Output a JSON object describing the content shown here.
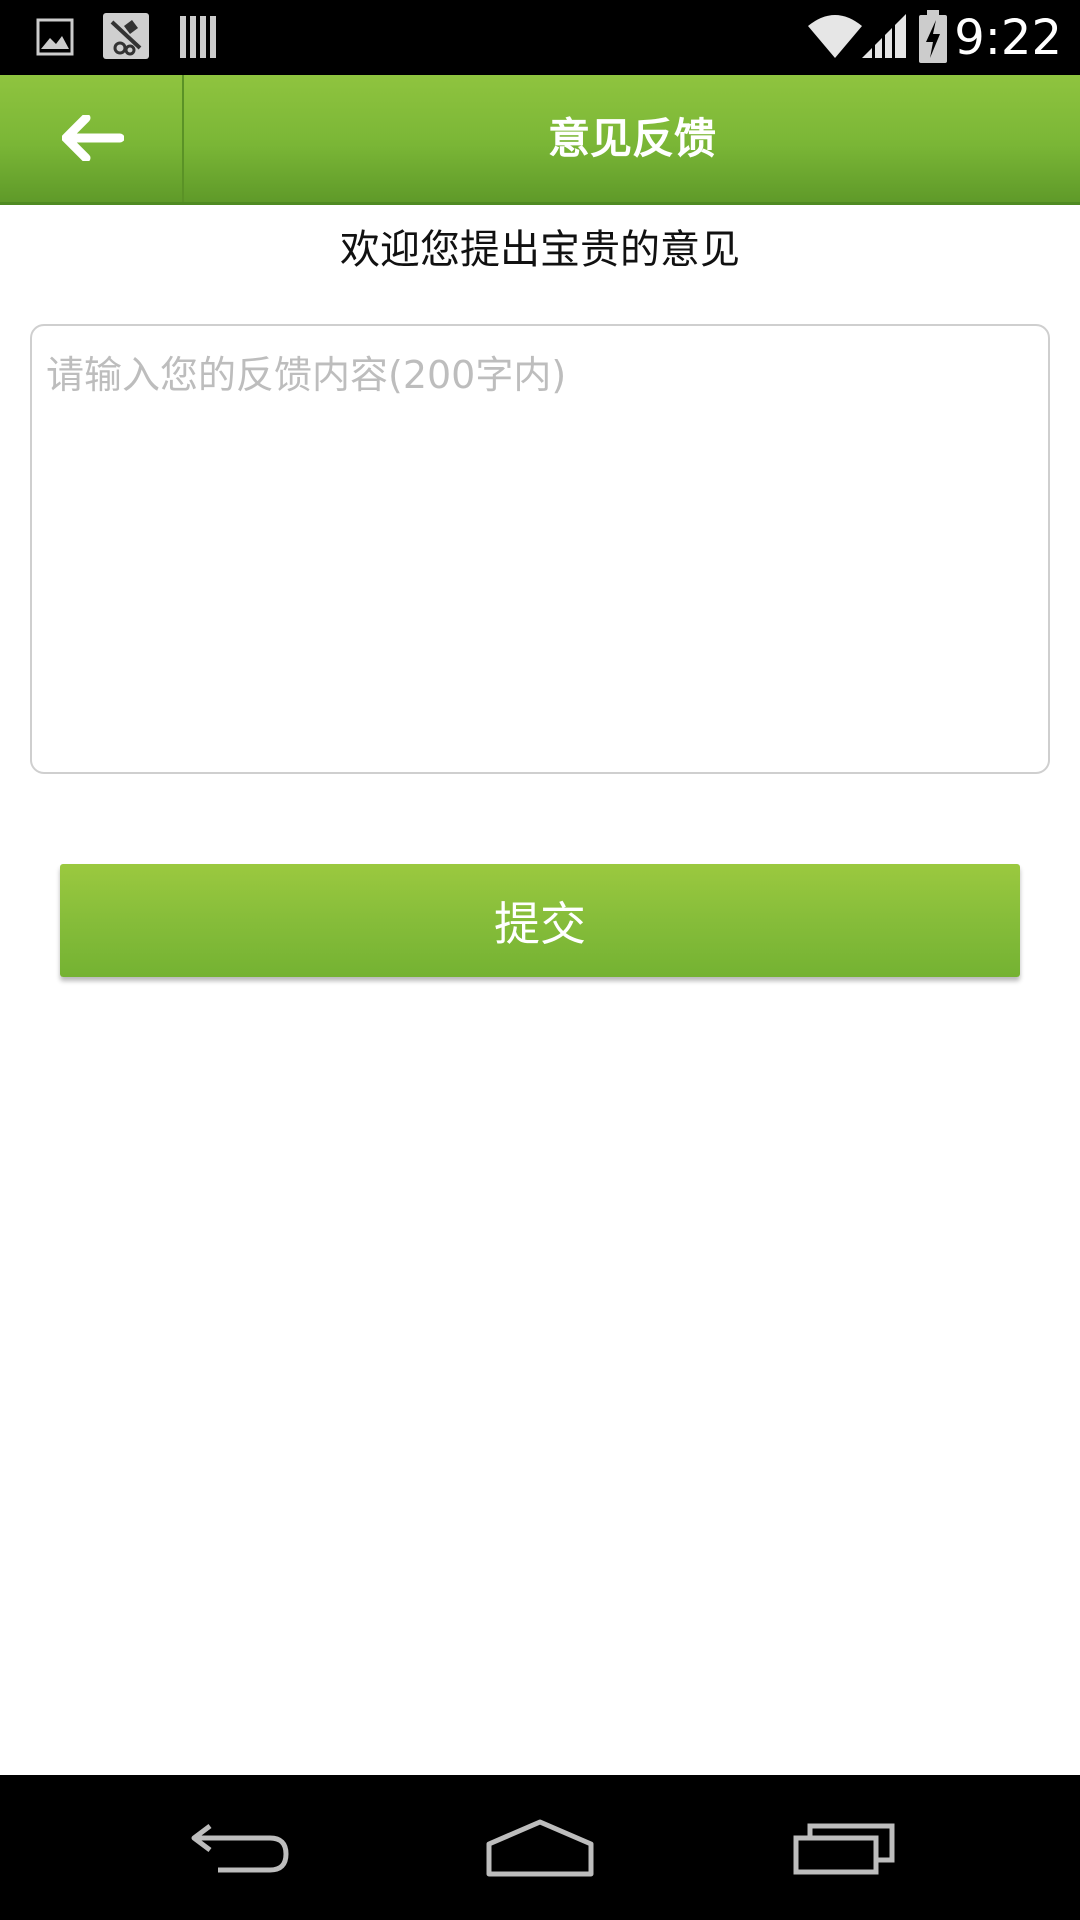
{
  "status_bar": {
    "time": "9:22",
    "icons": [
      "image-icon",
      "app-notification-icon",
      "barcode-icon",
      "wifi-icon",
      "signal-icon",
      "battery-charging-icon"
    ]
  },
  "action_bar": {
    "title": "意见反馈",
    "back_icon": "arrow-left-icon"
  },
  "content": {
    "welcome_text": "欢迎您提出宝贵的意见",
    "feedback_input": {
      "value": "",
      "placeholder": "请输入您的反馈内容(200字内)"
    },
    "submit_label": "提交"
  },
  "nav_bar": {
    "icons": [
      "back-nav-icon",
      "home-nav-icon",
      "recents-nav-icon"
    ]
  },
  "colors": {
    "accent_green": "#86bd3a",
    "status_bar_bg": "#000000",
    "text_primary": "#111111",
    "placeholder": "#bdbdbd"
  }
}
